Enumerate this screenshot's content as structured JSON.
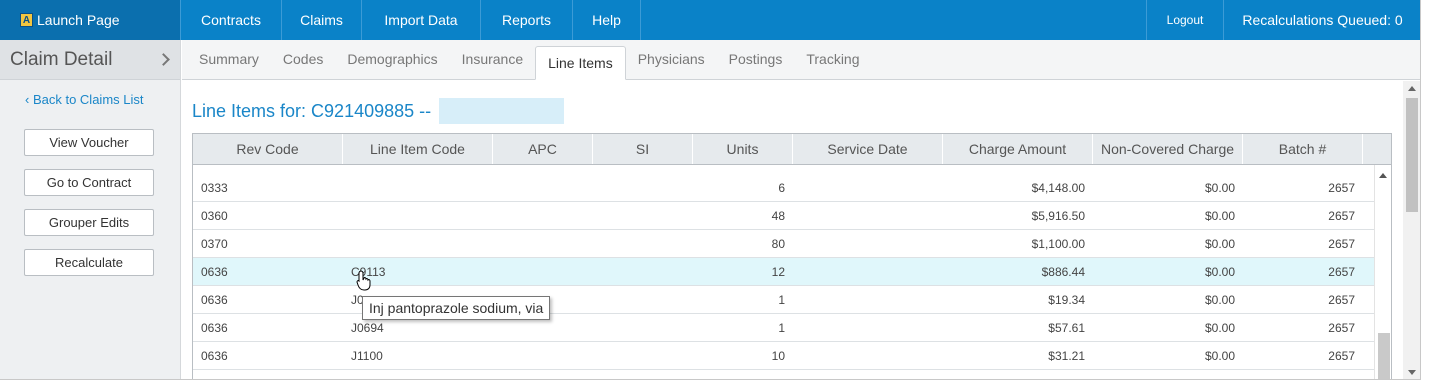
{
  "topnav": {
    "launch_label": "Launch Page",
    "logo_letter": "A",
    "items": [
      "Contracts",
      "Claims",
      "Import Data",
      "Reports",
      "Help"
    ],
    "logout": "Logout",
    "queued": "Recalculations Queued: 0"
  },
  "sidebar": {
    "title": "Claim Detail",
    "back_link": "Back to Claims List",
    "buttons": [
      "View Voucher",
      "Go to Contract",
      "Grouper Edits",
      "Recalculate"
    ]
  },
  "tabs": {
    "items": [
      "Summary",
      "Codes",
      "Demographics",
      "Insurance",
      "Line Items",
      "Physicians",
      "Postings",
      "Tracking"
    ],
    "active": "Line Items"
  },
  "main": {
    "title": "Line Items for: C921409885 --"
  },
  "grid": {
    "columns": [
      "Rev Code",
      "Line Item Code",
      "APC",
      "SI",
      "Units",
      "Service Date",
      "Charge Amount",
      "Non-Covered Charge",
      "Batch #"
    ],
    "rows": [
      [
        "0333",
        "",
        "",
        "",
        "6",
        "",
        "$4,148.00",
        "$0.00",
        "2657"
      ],
      [
        "0360",
        "",
        "",
        "",
        "48",
        "",
        "$5,916.50",
        "$0.00",
        "2657"
      ],
      [
        "0370",
        "",
        "",
        "",
        "80",
        "",
        "$1,100.00",
        "$0.00",
        "2657"
      ],
      [
        "0636",
        "C9113",
        "",
        "",
        "12",
        "",
        "$886.44",
        "$0.00",
        "2657"
      ],
      [
        "0636",
        "J0",
        "",
        "",
        "1",
        "",
        "$19.34",
        "$0.00",
        "2657"
      ],
      [
        "0636",
        "J0694",
        "",
        "",
        "1",
        "",
        "$57.61",
        "$0.00",
        "2657"
      ],
      [
        "0636",
        "J1100",
        "",
        "",
        "10",
        "",
        "$31.21",
        "$0.00",
        "2657"
      ]
    ],
    "selected_row_index": 3
  },
  "tooltip": {
    "text": "Inj pantoprazole sodium, via"
  }
}
